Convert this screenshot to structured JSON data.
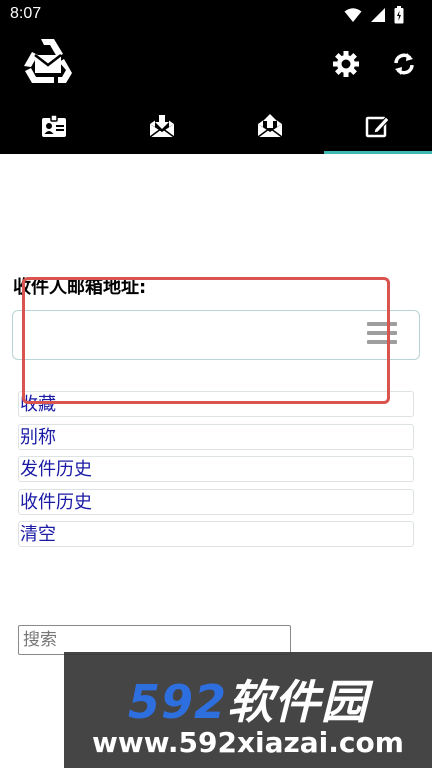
{
  "status_bar": {
    "time": "8:07",
    "icons": [
      "wifi-icon",
      "signal-icon",
      "battery-icon"
    ]
  },
  "app_bar": {
    "logo_icon": "recycle-mail-logo",
    "actions": [
      "gear-icon",
      "refresh-icon"
    ]
  },
  "tabs": [
    {
      "icon": "contact-card-icon",
      "active": false
    },
    {
      "icon": "mail-inbox-icon",
      "active": false
    },
    {
      "icon": "mail-outbox-icon",
      "active": false
    },
    {
      "icon": "compose-icon",
      "active": true
    }
  ],
  "compose": {
    "recipient_label": "收件人邮箱地址:",
    "recipient_value": "",
    "menu_icon": "menu-icon"
  },
  "options": [
    {
      "label": "收藏"
    },
    {
      "label": "别称"
    },
    {
      "label": "发件历史"
    },
    {
      "label": "收件历史"
    },
    {
      "label": "清空"
    }
  ],
  "search": {
    "placeholder": "搜索"
  },
  "watermark": {
    "number": "592",
    "brand": "软件园",
    "url": "www.592xiazai.com"
  },
  "colors": {
    "header_bg": "#000000",
    "tab_indicator": "#3fb7b3",
    "option_text": "#1a1aa6",
    "highlight": "#d9534f",
    "watermark_blue": "#2e6fe0"
  }
}
